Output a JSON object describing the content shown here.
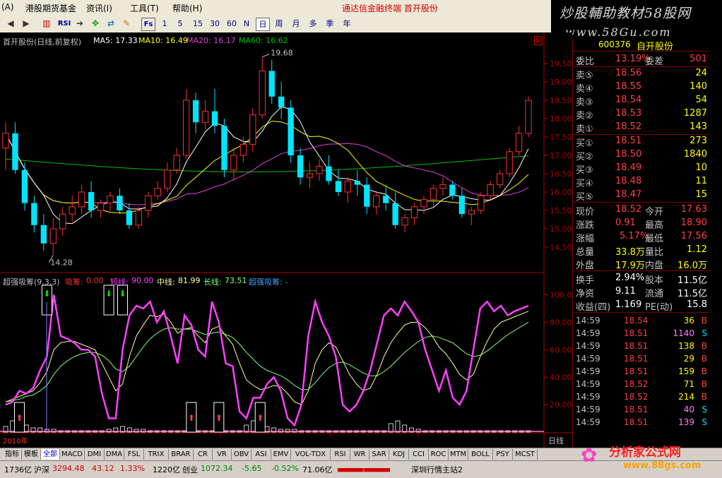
{
  "menu": {
    "items": [
      "(A)",
      "港股期货基金",
      "资讯(I)",
      "工具(T)",
      "帮助(H)"
    ],
    "title": "通达信金融终端  首开股份"
  },
  "toolbar": {
    "periods": [
      "1",
      "5",
      "15",
      "30",
      "60",
      "N",
      "日",
      "周",
      "月",
      "多",
      "季",
      "年"
    ],
    "selected": "日"
  },
  "watermark": {
    "line1": "炒股輔助教材58股网",
    "line2": "www.58Gu.com"
  },
  "main_header": {
    "stock": "首开股份(日线,前复权)",
    "ma5": "MA5: 17.33",
    "ma10": "MA10: 16.49",
    "ma20": "MA20: 16.17",
    "ma60": "MA60: 16.62",
    "high_mark": "19.68",
    "low_mark": "14.28"
  },
  "ind_header": {
    "name": "超强吸筹(9,3,3)",
    "xichou_label": "吸筹:",
    "xichou_val": "0.00",
    "short_label": "短线:",
    "short_val": "90.00",
    "mid_label": "中线:",
    "mid_val": "81.99",
    "long_label": "长线:",
    "long_val": "73.51",
    "signal": "超强吸筹: -"
  },
  "axis": {
    "date_label": "2010年",
    "period_label": "日线"
  },
  "colors": {
    "up": "#ff3030",
    "down": "#00e5ff",
    "ma5": "#ffffff",
    "ma10": "#ffff00",
    "ma20": "#e040e0",
    "ma60": "#00c000",
    "short": "#ff40ff",
    "mid": "#ffffa0",
    "long": "#80ff80"
  },
  "chart_data": [
    {
      "type": "candlestick",
      "title": "首开股份(日线,前复权)",
      "yticks": [
        "19.50",
        "19.00",
        "18.50",
        "18.00",
        "17.50",
        "17.00",
        "16.50",
        "16.00",
        "15.50",
        "15.00",
        "14.50"
      ],
      "ylim": [
        14.0,
        20.0
      ],
      "annotations": [
        {
          "text": "19.68",
          "value": 19.68
        },
        {
          "text": "14.28",
          "value": 14.28
        }
      ],
      "candles": [
        [
          17.2,
          17.9,
          16.6,
          17.6
        ],
        [
          17.6,
          17.9,
          16.5,
          16.6
        ],
        [
          16.6,
          16.8,
          15.5,
          15.7
        ],
        [
          15.7,
          15.9,
          14.9,
          15.1
        ],
        [
          15.1,
          15.4,
          14.4,
          14.6
        ],
        [
          14.6,
          15.3,
          14.3,
          15.0
        ],
        [
          15.0,
          15.6,
          14.8,
          15.4
        ],
        [
          15.4,
          15.9,
          15.2,
          15.6
        ],
        [
          15.6,
          16.2,
          15.4,
          16.0
        ],
        [
          16.0,
          16.3,
          15.3,
          15.5
        ],
        [
          15.5,
          15.8,
          15.3,
          15.7
        ],
        [
          15.7,
          16.0,
          15.5,
          15.9
        ],
        [
          15.9,
          16.1,
          15.4,
          15.5
        ],
        [
          15.5,
          15.7,
          15.0,
          15.1
        ],
        [
          15.1,
          15.6,
          15.0,
          15.5
        ],
        [
          15.5,
          16.0,
          15.3,
          15.9
        ],
        [
          15.9,
          16.3,
          15.8,
          16.1
        ],
        [
          16.1,
          16.8,
          16.0,
          16.6
        ],
        [
          16.6,
          17.2,
          16.5,
          17.0
        ],
        [
          17.0,
          18.8,
          16.9,
          18.5
        ],
        [
          18.5,
          18.7,
          17.6,
          17.9
        ],
        [
          17.9,
          18.5,
          17.7,
          18.2
        ],
        [
          18.2,
          18.8,
          17.6,
          17.8
        ],
        [
          17.8,
          18.0,
          16.4,
          16.6
        ],
        [
          16.6,
          17.2,
          16.3,
          17.0
        ],
        [
          17.0,
          17.5,
          16.8,
          17.3
        ],
        [
          17.3,
          18.3,
          17.1,
          18.1
        ],
        [
          18.1,
          19.7,
          18.0,
          19.3
        ],
        [
          19.3,
          19.6,
          18.4,
          18.6
        ],
        [
          18.6,
          19.0,
          18.0,
          18.3
        ],
        [
          18.3,
          18.5,
          16.8,
          17.0
        ],
        [
          17.0,
          17.2,
          16.2,
          16.4
        ],
        [
          16.4,
          16.8,
          16.1,
          16.5
        ],
        [
          16.5,
          16.9,
          16.3,
          16.7
        ],
        [
          16.7,
          17.0,
          16.2,
          16.3
        ],
        [
          16.3,
          16.6,
          15.9,
          16.0
        ],
        [
          16.0,
          16.4,
          15.7,
          16.3
        ],
        [
          16.3,
          16.6,
          15.9,
          16.2
        ],
        [
          16.2,
          16.4,
          15.4,
          15.6
        ],
        [
          15.6,
          16.0,
          15.4,
          15.9
        ],
        [
          15.9,
          16.2,
          15.5,
          15.7
        ],
        [
          15.7,
          16.0,
          15.0,
          15.1
        ],
        [
          15.1,
          15.4,
          14.9,
          15.3
        ],
        [
          15.3,
          15.7,
          15.1,
          15.6
        ],
        [
          15.6,
          15.9,
          15.4,
          15.8
        ],
        [
          15.8,
          16.2,
          15.6,
          16.1
        ],
        [
          16.1,
          16.4,
          15.9,
          16.2
        ],
        [
          16.2,
          16.3,
          15.8,
          15.9
        ],
        [
          15.9,
          16.1,
          15.3,
          15.4
        ],
        [
          15.4,
          15.6,
          15.1,
          15.5
        ],
        [
          15.5,
          16.0,
          15.4,
          15.9
        ],
        [
          15.9,
          16.3,
          15.8,
          16.2
        ],
        [
          16.2,
          16.6,
          16.1,
          16.5
        ],
        [
          16.5,
          17.2,
          16.4,
          17.1
        ],
        [
          17.1,
          17.8,
          17.0,
          17.6
        ],
        [
          17.6,
          18.6,
          17.5,
          18.5
        ]
      ]
    },
    {
      "type": "line",
      "title": "超强吸筹(9,3,3)",
      "yticks": [
        "100.00",
        "80.00",
        "60.00",
        "40.00",
        "20.00"
      ],
      "ylim": [
        0,
        110
      ],
      "series": [
        {
          "name": "短线",
          "values": [
            20,
            22,
            30,
            28,
            32,
            45,
            55,
            100,
            70,
            68,
            65,
            60,
            60,
            55,
            28,
            10,
            10,
            60,
            85,
            92,
            90,
            95,
            80,
            88,
            70,
            50,
            85,
            78,
            60,
            55,
            95,
            80,
            50,
            48,
            15,
            10,
            25,
            25,
            35,
            40,
            30,
            10,
            5,
            20,
            70,
            95,
            80,
            70,
            55,
            20,
            15,
            20,
            30,
            45,
            65,
            85,
            90,
            85,
            95,
            88,
            80,
            60,
            45,
            30,
            45,
            25,
            20,
            30,
            60,
            90,
            95,
            88,
            92,
            85,
            88,
            90,
            92
          ]
        },
        {
          "name": "中线",
          "values": [
            22,
            24,
            26,
            28,
            30,
            36,
            44,
            60,
            65,
            66,
            66,
            64,
            62,
            60,
            50,
            40,
            30,
            35,
            55,
            70,
            78,
            85,
            84,
            86,
            80,
            72,
            75,
            76,
            70,
            65,
            75,
            77,
            70,
            64,
            50,
            38,
            34,
            31,
            32,
            34,
            33,
            28,
            22,
            20,
            30,
            50,
            60,
            65,
            62,
            52,
            42,
            35,
            30,
            32,
            42,
            55,
            65,
            72,
            78,
            80,
            80,
            76,
            70,
            62,
            57,
            50,
            42,
            38,
            42,
            55,
            66,
            75,
            80,
            82,
            84,
            86,
            88
          ]
        },
        {
          "name": "长线",
          "values": [
            22,
            23,
            24,
            26,
            27,
            30,
            34,
            42,
            48,
            52,
            55,
            57,
            58,
            58,
            56,
            52,
            46,
            44,
            48,
            55,
            62,
            68,
            72,
            75,
            76,
            75,
            75,
            75,
            73,
            71,
            72,
            73,
            71,
            69,
            64,
            58,
            53,
            48,
            45,
            43,
            41,
            38,
            34,
            31,
            31,
            36,
            42,
            47,
            50,
            51,
            49,
            46,
            43,
            41,
            41,
            44,
            48,
            53,
            58,
            62,
            66,
            69,
            70,
            69,
            67,
            65,
            61,
            57,
            55,
            56,
            59,
            63,
            67,
            71,
            74,
            77,
            80
          ]
        }
      ]
    }
  ],
  "quote": {
    "code": "600376",
    "name": "自开股份",
    "rows": [
      {
        "l1": "委比",
        "v1": "13.19%",
        "l2": "委差",
        "v2": "501"
      },
      {
        "l1": "卖⑤",
        "v1": "18.56",
        "v2": "24"
      },
      {
        "l1": "卖④",
        "v1": "18.55",
        "v2": "140"
      },
      {
        "l1": "卖③",
        "v1": "18.54",
        "v2": "54"
      },
      {
        "l1": "卖②",
        "v1": "18.53",
        "v2": "1287"
      },
      {
        "l1": "卖①",
        "v1": "18.52",
        "v2": "143"
      },
      {
        "l1": "买①",
        "v1": "18.51",
        "v2": "273"
      },
      {
        "l1": "买②",
        "v1": "18.50",
        "v2": "1840"
      },
      {
        "l1": "买③",
        "v1": "18.49",
        "v2": "10"
      },
      {
        "l1": "买④",
        "v1": "18.48",
        "v2": "11"
      },
      {
        "l1": "买⑤",
        "v1": "18.47",
        "v2": "15"
      },
      {
        "l1": "现价",
        "v1": "18.52",
        "l2": "今开",
        "v2": "17.63"
      },
      {
        "l1": "涨跌",
        "v1": "0.91",
        "l2": "最高",
        "v2": "18.90"
      },
      {
        "l1": "涨幅",
        "v1": "5.17%",
        "l2": "最低",
        "v2": "17.56"
      },
      {
        "l1": "总量",
        "v1": "33.8万",
        "l2": "量比",
        "v2": "1.12"
      },
      {
        "l1": "外盘",
        "v1": "17.9万",
        "l2": "内盘",
        "v2": "16.0万"
      },
      {
        "l1": "换手",
        "v1": "2.94%",
        "l2": "股本",
        "v2": "11.5亿"
      },
      {
        "l1": "净资",
        "v1": "9.11",
        "l2": "流通",
        "v2": "11.5亿"
      },
      {
        "l1": "收益(四)",
        "v1": "1.169",
        "l2": "PE(动)",
        "v2": "15.8"
      }
    ],
    "ticks": [
      {
        "t": "14:59",
        "p": "18.54",
        "v": "36",
        "bs": "B"
      },
      {
        "t": "14:59",
        "p": "18.51",
        "v": "1140",
        "bs": "S"
      },
      {
        "t": "14:59",
        "p": "18.51",
        "v": "138",
        "bs": "B"
      },
      {
        "t": "14:59",
        "p": "18.51",
        "v": "29",
        "bs": "B"
      },
      {
        "t": "14:59",
        "p": "18.51",
        "v": "159",
        "bs": "B"
      },
      {
        "t": "14:59",
        "p": "18.52",
        "v": "71",
        "bs": "B"
      },
      {
        "t": "14:59",
        "p": "18.52",
        "v": "214",
        "bs": "B"
      },
      {
        "t": "14:59",
        "p": "18.51",
        "v": "40",
        "bs": "S"
      },
      {
        "t": "14:59",
        "p": "18.51",
        "v": "139",
        "bs": "S"
      }
    ]
  },
  "tabs": [
    "指标",
    "模板",
    "全部",
    "MACD",
    "DMI",
    "DMA",
    "FSL",
    "TRIX",
    "BRAR",
    "CR",
    "VR",
    "OBV",
    "ASI",
    "EMV",
    "VOL-TDX",
    "RSI",
    "WR",
    "SAR",
    "KDJ",
    "CCI",
    "ROC",
    "MTM",
    "BOLL",
    "PSY",
    "MCST"
  ],
  "status": {
    "s1": "1736亿",
    "s2": "沪深",
    "s3": "3294.48",
    "s4": "43.12",
    "s5": "1.33%",
    "s6": "1220亿",
    "s7": "创业",
    "s8": "1072.34",
    "s9": "-5.65",
    "s10": "-0.52%",
    "s11": "71.06亿",
    "s12": "深圳行情主站2"
  },
  "logo": {
    "t1": "分析家公式网",
    "t2": "www.88gs.com"
  }
}
